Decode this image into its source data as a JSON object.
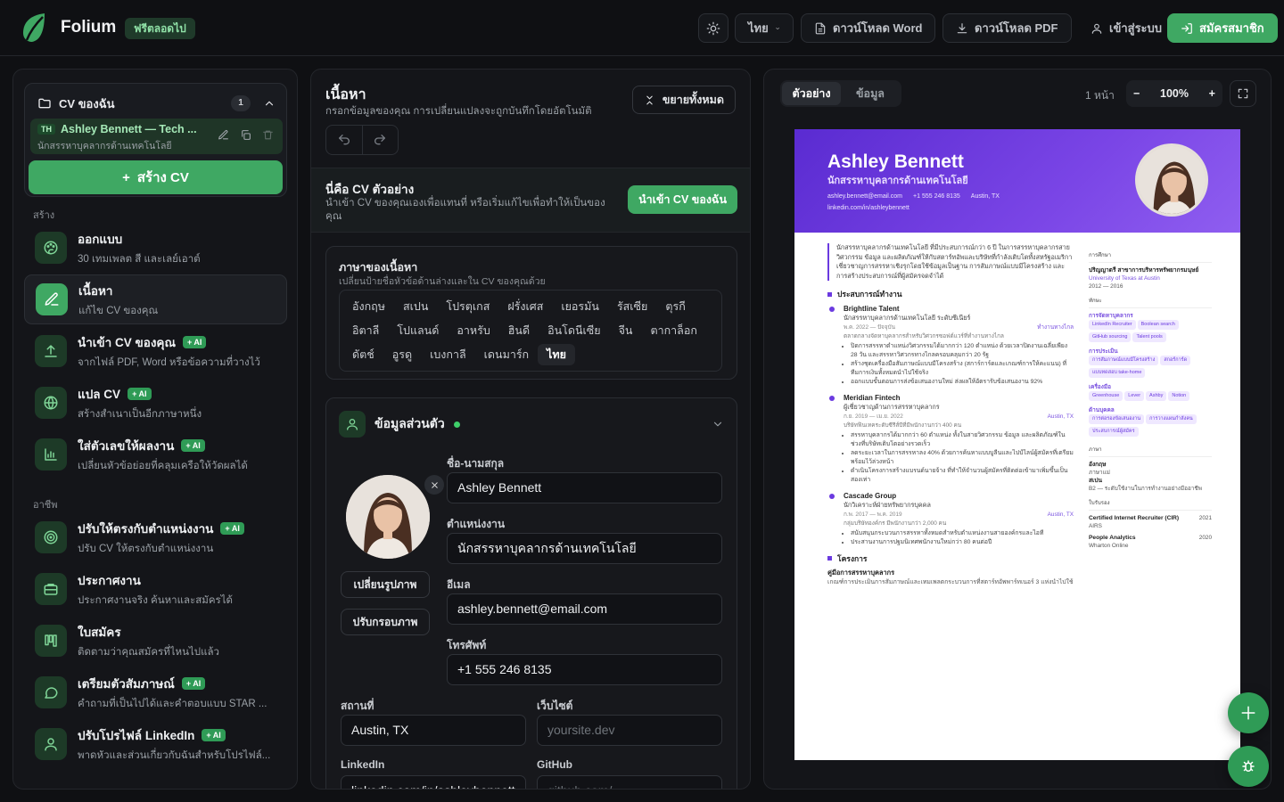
{
  "header": {
    "app_name": "Folium",
    "free_badge": "ฟรีตลอดไป",
    "language": "ไทย",
    "download_word": "ดาวน์โหลด Word",
    "download_pdf": "ดาวน์โหลด PDF",
    "login": "เข้าสู่ระบบ",
    "signup": "สมัครสมาชิก"
  },
  "sidebar": {
    "my_cv_title": "CV ของฉัน",
    "cv_count": "1",
    "cv_item": {
      "lang": "TH",
      "title": "Ashley Bennett — Tech ...",
      "subtitle": "นักสรรหาบุคลากรด้านเทคโนโลยี"
    },
    "create_cv": "สร้าง CV",
    "section_create": "สร้าง",
    "section_career": "อาชีพ",
    "items_create": [
      {
        "title": "ออกแบบ",
        "subtitle": "30 เทมเพลต สี และเลย์เอาต์",
        "ai": "",
        "icon": "palette-icon"
      },
      {
        "title": "เนื้อหา",
        "subtitle": "แก้ไข CV ของคุณ",
        "ai": "",
        "icon": "pencil-icon"
      },
      {
        "title": "นำเข้า CV ของคุณ",
        "subtitle": "จากไฟล์ PDF, Word หรือข้อความที่วางไว้",
        "ai": "+ AI",
        "icon": "upload-icon"
      },
      {
        "title": "แปล CV",
        "subtitle": "สร้างสำเนาเป็นอีกภาษาหนึ่ง",
        "ai": "+ AI",
        "icon": "globe-icon"
      },
      {
        "title": "ใส่ตัวเลขให้ผลงาน",
        "subtitle": "เปลี่ยนหัวข้อย่อยที่คลุมเครือให้วัดผลได้",
        "ai": "+ AI",
        "icon": "chart-icon"
      }
    ],
    "items_career": [
      {
        "title": "ปรับให้ตรงกับตำแหน่งงาน",
        "subtitle": "ปรับ CV ให้ตรงกับตำแหน่งงาน",
        "ai": "+ AI",
        "icon": "target-icon"
      },
      {
        "title": "ประกาศงาน",
        "subtitle": "ประกาศงานจริง ค้นหาและสมัครได้",
        "ai": "",
        "icon": "briefcase-icon"
      },
      {
        "title": "ใบสมัคร",
        "subtitle": "ติดตามว่าคุณสมัครที่ไหนไปแล้ว",
        "ai": "",
        "icon": "kanban-icon"
      },
      {
        "title": "เตรียมตัวสัมภาษณ์",
        "subtitle": "คำถามที่เป็นไปได้และคำตอบแบบ STAR ...",
        "ai": "+ AI",
        "icon": "chat-icon"
      },
      {
        "title": "ปรับโปรไฟล์ LinkedIn",
        "subtitle": "พาดหัวและส่วนเกี่ยวกับฉันสำหรับโปรไฟล์...",
        "ai": "+ AI",
        "icon": "user-icon"
      }
    ]
  },
  "editor": {
    "title": "เนื้อหา",
    "subtitle": "กรอกข้อมูลของคุณ การเปลี่ยนแปลงจะถูกบันทึกโดยอัตโนมัติ",
    "collapse_all": "ขยายทั้งหมด",
    "sample_title": "นี่คือ CV ตัวอย่าง",
    "sample_desc": "นำเข้า CV ของคุณเองเพื่อแทนที่ หรือเริ่มแก้ไขเพื่อทำให้เป็นของคุณ",
    "import_btn": "นำเข้า CV ของฉัน",
    "content_lang_title": "ภาษาของเนื้อหา",
    "content_lang_sub": "เปลี่ยนป้ายชื่อหัวข้อด้านล่างและใน CV ของคุณด้วย",
    "languages": [
      "อังกฤษ",
      "สเปน",
      "โปรตุเกส",
      "ฝรั่งเศส",
      "เยอรมัน",
      "รัสเซีย",
      "ตุรกี",
      "อิตาลี",
      "โปแลนด์",
      "อาหรับ",
      "ฮินดี",
      "อินโดนีเซีย",
      "จีน",
      "ตากาล็อก",
      "ดัตช์",
      "อูรดู",
      "เบงกาลี",
      "เดนมาร์ก",
      "ไทย"
    ],
    "selected_language": "ไทย",
    "personal_title": "ข้อมูลส่วนตัว",
    "change_photo": "เปลี่ยนรูปภาพ",
    "crop_photo": "ปรับกรอบภาพ",
    "fields": {
      "name_label": "ชื่อ-นามสกุล",
      "name": "Ashley Bennett",
      "title_label": "ตำแหน่งงาน",
      "title": "นักสรรหาบุคลากรด้านเทคโนโลยี",
      "email_label": "อีเมล",
      "email": "ashley.bennett@email.com",
      "phone_label": "โทรศัพท์",
      "phone": "+1 555 246 8135",
      "location_label": "สถานที่",
      "location": "Austin, TX",
      "website_label": "เว็บไซต์",
      "website_ph": "yoursite.dev",
      "linkedin_label": "LinkedIn",
      "linkedin": "linkedin.com/in/ashleybennett",
      "github_label": "GitHub",
      "github_ph": "github.com/..."
    }
  },
  "preview": {
    "tab_preview": "ตัวอย่าง",
    "tab_data": "ข้อมูล",
    "pages": "1 หน้า",
    "zoom": "100%",
    "cv": {
      "name": "Ashley Bennett",
      "role": "นักสรรหาบุคลากรด้านเทคโนโลยี",
      "email": "ashley.bennett@email.com",
      "phone": "+1 555 246 8135",
      "location": "Austin, TX",
      "linkedin": "linkedin.com/in/ashleybennett",
      "summary": "นักสรรหาบุคลากรด้านเทคโนโลยี ที่มีประสบการณ์กว่า 6 ปี ในการสรรหาบุคลากรสายวิศวกรรม ข้อมูล และผลิตภัณฑ์ให้กับสตาร์ทอัพและบริษัทที่กำลังเติบโตทั้งสหรัฐอเมริกา เชี่ยวชาญการสรรหาเชิงรุกโดยใช้ข้อมูลเป็นฐาน การสัมภาษณ์แบบมีโครงสร้าง และการสร้างประสบการณ์ที่ผู้สมัครจดจำได้",
      "experience_h": "ประสบการณ์ทำงาน",
      "jobs": [
        {
          "company": "Brightline Talent",
          "role": "นักสรรหาบุคลากรด้านเทคโนโลยี ระดับซีเนียร์",
          "dates": "พ.ค. 2022 — ปัจจุบัน",
          "loc": "ทำงานทางไกล",
          "desc": "ตลาดกลางจัดหาบุคลากรสำหรับวิศวกรซอฟต์แวร์ที่ทำงานทางไกล",
          "bullets": [
            "ปิดการสรรหาตำแหน่งวิศวกรรมได้มากกว่า 120 ตำแหน่ง ด้วยเวลาปิดงานเฉลี่ยเพียง 28 วัน และสรรหาวิศวกรทางไกลครอบคลุมกว่า 20 รัฐ",
            "สร้างชุดเครื่องมือสัมภาษณ์แบบมีโครงสร้าง (สการ์การ์ดและเกณฑ์การให้คะแนน) ที่ทีมการเงินทั้งหมดนำไปใช้จริง",
            "ออกแบบขั้นตอนการส่งข้อเสนองานใหม่ ส่งผลให้อัตรารับข้อเสนองาน 92%"
          ]
        },
        {
          "company": "Meridian Fintech",
          "role": "ผู้เชี่ยวชาญด้านการสรรหาบุคลากร",
          "dates": "ก.ย. 2019 — เม.ย. 2022",
          "loc": "Austin, TX",
          "desc": "บริษัทฟินเทคระดับซีรีส์บีที่มีพนักงานกว่า 400 คน",
          "bullets": [
            "สรรหาบุคลากรได้มากกว่า 60 ตำแหน่ง ทั้งในสายวิศวกรรม ข้อมูล และผลิตภัณฑ์ในช่วงที่บริษัทเติบโตอย่างรวดเร็ว",
            "ลดระยะเวลาในการสรรหาลง 40% ด้วยการค้นหาแบบบูลีนและไปป์ไลน์ผู้สมัครที่เตรียมพร้อมไว้ล่วงหน้า",
            "ดำเนินโครงการสร้างแบรนด์นายจ้าง ที่ทำให้จำนวนผู้สมัครที่ติดต่อเข้ามาเพิ่มขึ้นเป็นสองเท่า"
          ]
        },
        {
          "company": "Cascade Group",
          "role": "นักวิเคราะห์ฝ่ายทรัพยากรบุคคล",
          "dates": "ก.พ. 2017 — พ.ค. 2019",
          "loc": "Austin, TX",
          "desc": "กลุ่มบริษัทองค์กร มีพนักงานกว่า 2,000 คน",
          "bullets": [
            "สนับสนุนกระบวนการสรรหาทั้งหมดสำหรับตำแหน่งงานสายองค์กรและไอที",
            "ประสานงานการปฐมนิเทศพนักงานใหม่กว่า 80 คนต่อปี"
          ]
        }
      ],
      "projects_h": "โครงการ",
      "project_title": "คู่มือการสรรหาบุคลากร",
      "project_desc": "เกณฑ์การประเมินการสัมภาษณ์และเทมเพลตกระบวนการที่สตาร์ทอัพพาร์ทเนอร์ 3 แห่งนำไปใช้",
      "education_h": "การศึกษา",
      "edu_degree": "ปริญญาตรี สาขาการบริหารทรัพยากรมนุษย์",
      "edu_school": "University of Texas at Austin",
      "edu_dates": "2012 — 2016",
      "skills_h": "ทักษะ",
      "skill_groups": [
        {
          "name": "การจัดหาบุคลากร",
          "chips": [
            "LinkedIn Recruiter",
            "Boolean search",
            "GitHub sourcing",
            "Talent pools"
          ]
        },
        {
          "name": "การประเมิน",
          "chips": [
            "การสัมภาษณ์แบบมีโครงสร้าง",
            "สกอร์การ์ด",
            "แบบทดสอบ take-home"
          ]
        },
        {
          "name": "เครื่องมือ",
          "chips": [
            "Greenhouse",
            "Lever",
            "Ashby",
            "Notion"
          ]
        },
        {
          "name": "ด้านบุคคล",
          "chips": [
            "การต่อรองข้อเสนองาน",
            "การวางแผนกำลังคน",
            "ประสบการณ์ผู้สมัคร"
          ]
        }
      ],
      "languages_h": "ภาษา",
      "lang1": "อังกฤษ",
      "lang1_level": "ภาษาแม่",
      "lang2": "สเปน",
      "lang2_level": "B2 — ระดับใช้งานในการทำงานอย่างมืออาชีพ",
      "certs_h": "ใบรับรอง",
      "cert1": "Certified Internet Recruiter (CIR)",
      "cert1_org": "AIRS",
      "cert1_year": "2021",
      "cert2": "People Analytics",
      "cert2_org": "Wharton Online",
      "cert2_year": "2020"
    }
  }
}
